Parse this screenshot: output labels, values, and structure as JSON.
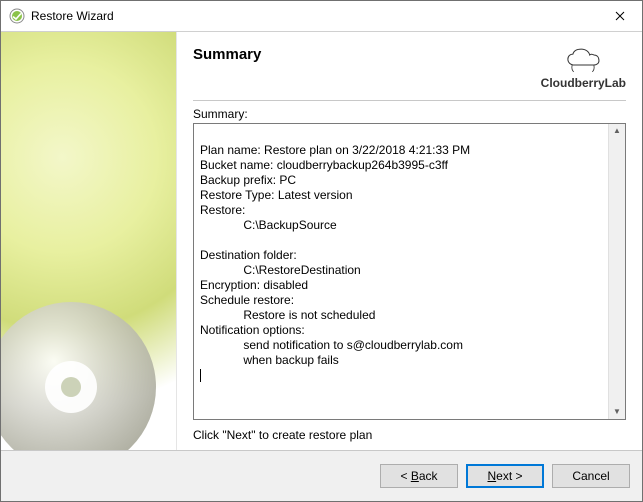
{
  "window": {
    "title": "Restore Wizard"
  },
  "header": {
    "heading": "Summary",
    "brand": "CloudberryLab"
  },
  "summary": {
    "label": "Summary:",
    "lines": {
      "l1": "Plan name: Restore plan on 3/22/2018 4:21:33 PM",
      "l2": "Bucket name: cloudberrybackup264b3995-c3ff",
      "l3": "Backup prefix: PC",
      "l4": "Restore Type: Latest version",
      "l5": "Restore:",
      "l6": "             C:\\BackupSource",
      "l7": "",
      "l8": "Destination folder:",
      "l9": "             C:\\RestoreDestination",
      "l10": "Encryption: disabled",
      "l11": "Schedule restore:",
      "l12": "             Restore is not scheduled",
      "l13": "Notification options:",
      "l14": "             send notification to s@cloudberrylab.com",
      "l15": "             when backup fails"
    }
  },
  "hint": "Click \"Next\" to create restore plan",
  "buttons": {
    "back_pre": "< ",
    "back_key": "B",
    "back_post": "ack",
    "next_key": "N",
    "next_post": "ext >",
    "cancel": "Cancel"
  }
}
